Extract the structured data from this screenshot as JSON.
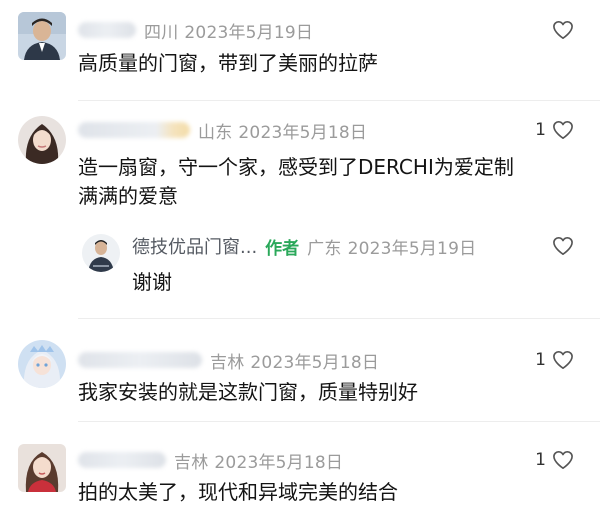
{
  "comments": [
    {
      "location": "四川",
      "date": "2023年5月19日",
      "text": "高质量的门窗，带到了美丽的拉萨",
      "likes": ""
    },
    {
      "location": "山东",
      "date": "2023年5月18日",
      "text_line1": "造一扇窗，守一个家，感受到了DERCHI为爱定制",
      "text_line2": "满满的爱意",
      "likes": "1"
    },
    {
      "location": "吉林",
      "date": "2023年5月18日",
      "text": "我家安装的就是这款门窗，质量特别好",
      "likes": "1"
    },
    {
      "location": "吉林",
      "date": "2023年5月18日",
      "text": "拍的太美了，现代和异域完美的结合",
      "likes": "1"
    }
  ],
  "reply": {
    "author": "德技优品门窗...",
    "tag": "作者",
    "location": "广东",
    "date": "2023年5月19日",
    "text": "谢谢",
    "likes": ""
  },
  "icons": {
    "like": "heart-outline-icon"
  },
  "colors": {
    "meta": "#9b9b9b",
    "author_tag": "#2aa85a",
    "text": "#141414"
  }
}
